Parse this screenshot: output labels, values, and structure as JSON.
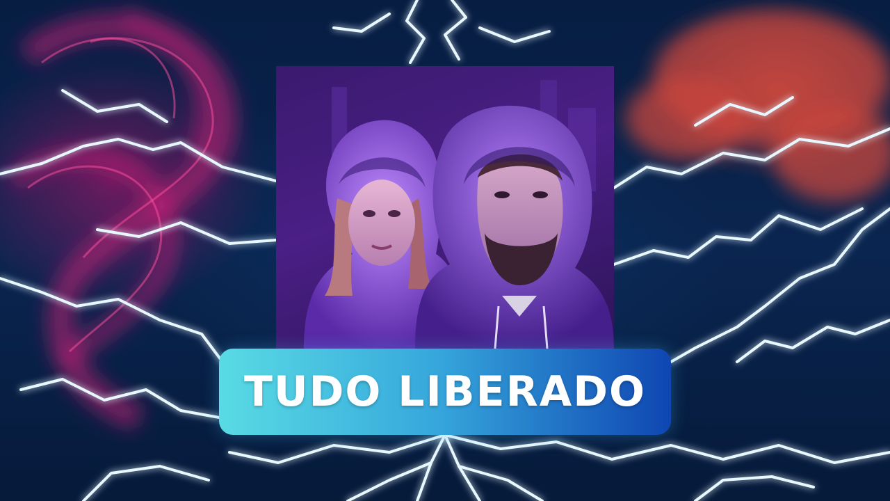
{
  "banner": {
    "label": "TUDO LIBERADO"
  },
  "background": {
    "theme": "lightning-storm",
    "colors": {
      "base": "#061a3a",
      "smoke_left": "#be146e",
      "smoke_right": "#c8463c",
      "lightning_glow": "#3fd0e6"
    }
  },
  "poster": {
    "subject": "two-hooded-figures-illustration",
    "accent": "#6a35c4"
  }
}
